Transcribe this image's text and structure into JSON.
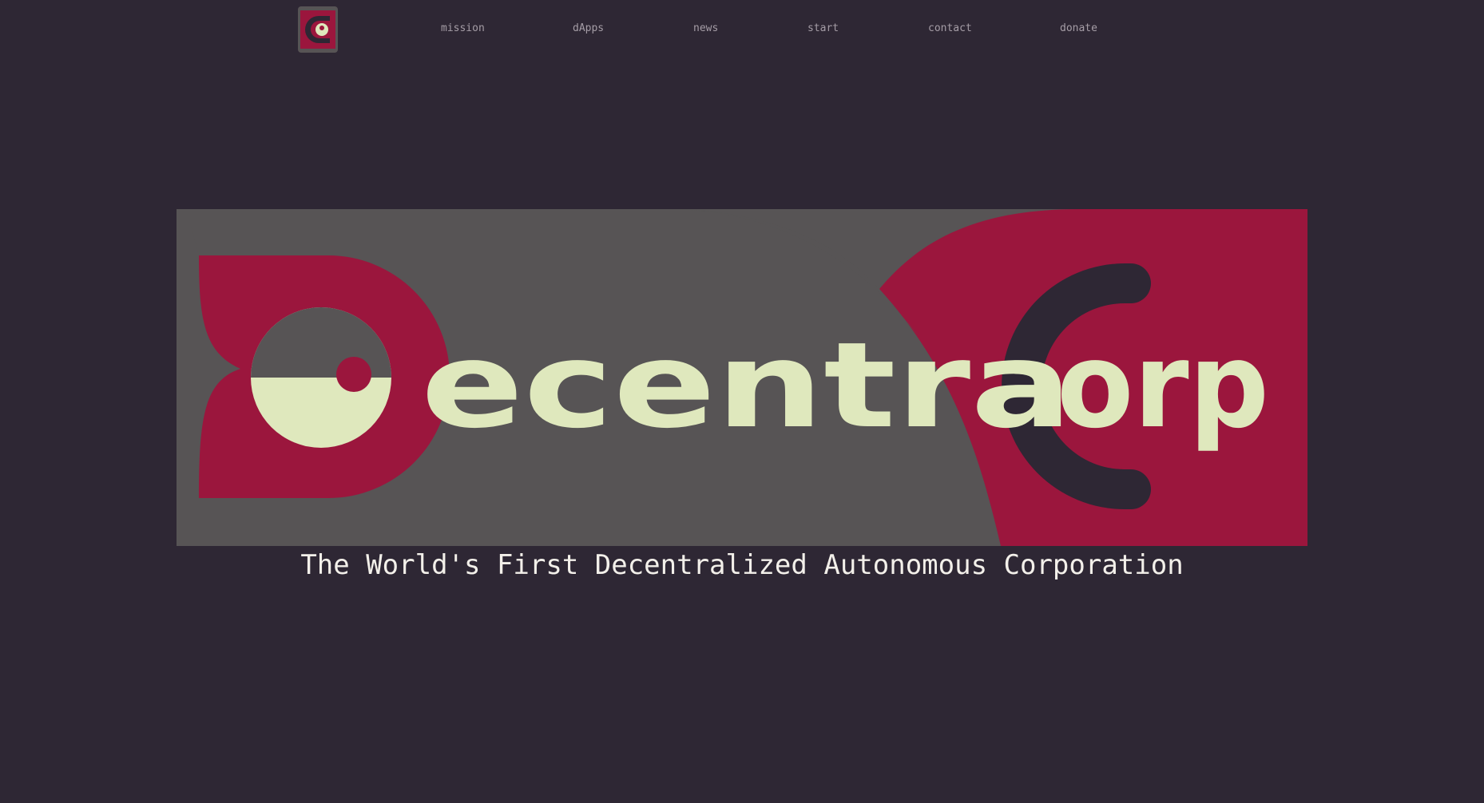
{
  "nav": {
    "logo_icon": "decentracorp-logo-icon",
    "links": [
      {
        "label": "mission"
      },
      {
        "label": "dApps"
      },
      {
        "label": "news"
      },
      {
        "label": "start"
      },
      {
        "label": "contact"
      },
      {
        "label": "donate"
      }
    ]
  },
  "hero": {
    "logo_text": "DecentraCorp",
    "tagline": "The World's First Decentralized Autonomous Corporation"
  },
  "colors": {
    "background": "#2e2734",
    "panel_gray": "#575455",
    "crimson": "#9b163d",
    "pale_green": "#dfe8bd",
    "nav_text": "#a59da6",
    "tagline_text": "#f3f0ea"
  }
}
